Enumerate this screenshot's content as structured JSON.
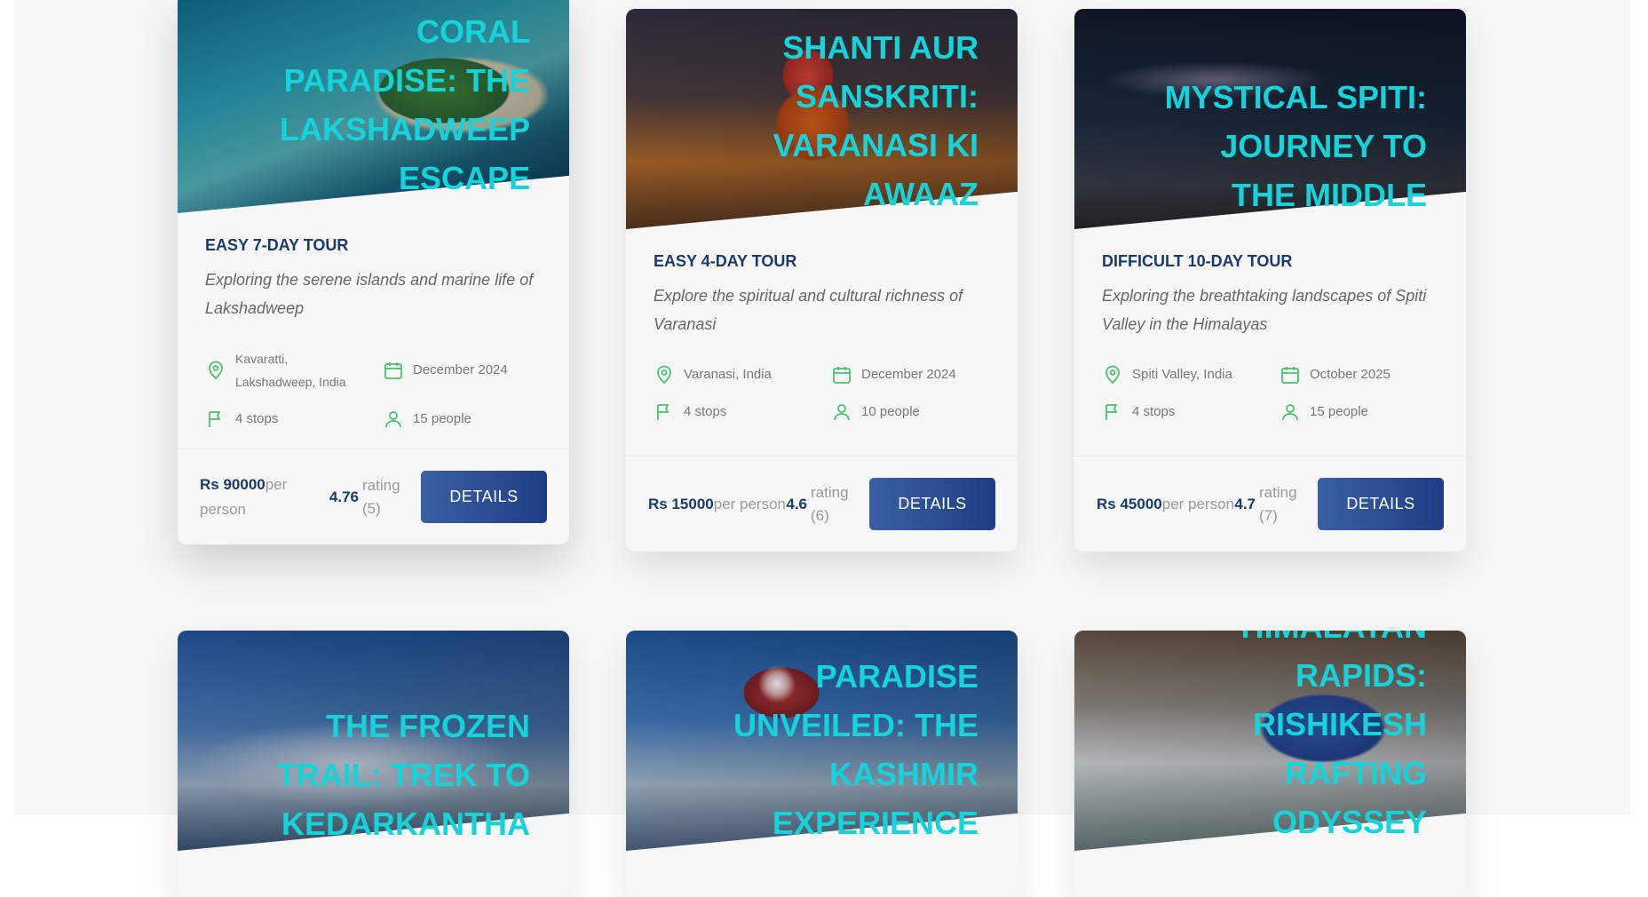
{
  "colors": {
    "title": "#16d3da",
    "heading": "#1b3a6b",
    "icon": "#4cc06f",
    "button": "#2b4d96"
  },
  "icons": {
    "location": "location-pin-icon",
    "date": "calendar-icon",
    "stops": "flag-icon",
    "people": "person-icon"
  },
  "tours": [
    {
      "title": "Coral Paradise: The Lakshadweep Escape",
      "subheading": "Easy 7-day tour",
      "summary": "Exploring the serene islands and marine life of Lakshadweep",
      "location": "Kavaratti, Lakshadweep, India",
      "date": "December 2024",
      "stops": "4 stops",
      "people": "15 people",
      "price": "Rs 90000",
      "price_unit": "per person",
      "rating": "4.76",
      "rating_label": "rating (5)",
      "button": "Details"
    },
    {
      "title": "Shanti Aur Sanskriti: Varanasi Ki Awaaz",
      "subheading": "Easy 4-day tour",
      "summary": "Explore the spiritual and cultural richness of Varanasi",
      "location": "Varanasi, India",
      "date": "December 2024",
      "stops": "4 stops",
      "people": "10 people",
      "price": "Rs 15000",
      "price_unit": "per person",
      "rating": "4.6",
      "rating_label": "rating (6)",
      "button": "Details"
    },
    {
      "title": "Mystical Spiti: Journey to the Middle Land",
      "subheading": "Difficult 10-day tour",
      "summary": "Exploring the breathtaking landscapes of Spiti Valley in the Himalayas",
      "location": "Spiti Valley, India",
      "date": "October 2025",
      "stops": "4 stops",
      "people": "15 people",
      "price": "Rs 45000",
      "price_unit": "per person",
      "rating": "4.7",
      "rating_label": "rating (7)",
      "button": "Details"
    },
    {
      "title": "The Frozen Trail: Trek to Kedarkantha"
    },
    {
      "title": "Paradise Unveiled: The Kashmir Experience"
    },
    {
      "title": "Himalayan Rapids: Rishikesh Rafting Odyssey"
    }
  ]
}
